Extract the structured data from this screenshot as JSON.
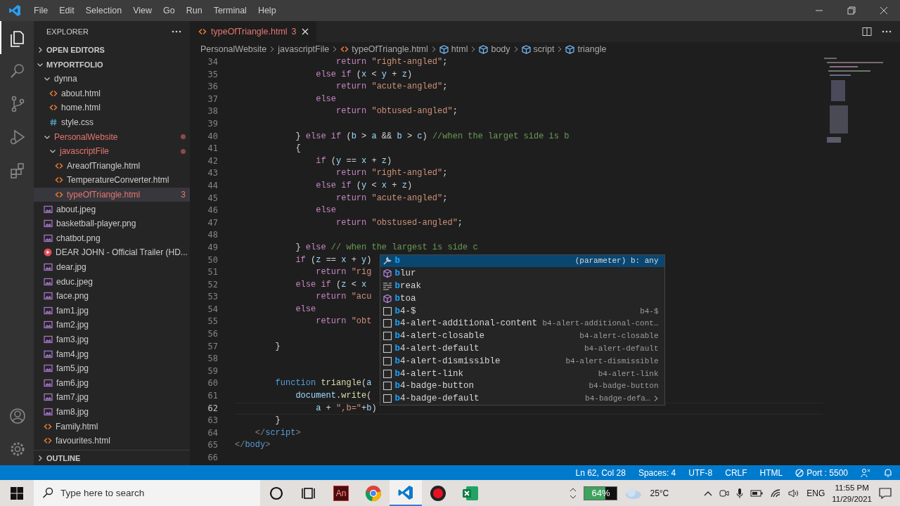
{
  "menu": [
    "File",
    "Edit",
    "Selection",
    "View",
    "Go",
    "Run",
    "Terminal",
    "Help"
  ],
  "activity_bar": [
    {
      "kind": "files",
      "selected": true
    },
    {
      "kind": "search",
      "selected": false
    },
    {
      "kind": "source-control",
      "selected": false
    },
    {
      "kind": "run",
      "selected": false
    },
    {
      "kind": "extensions",
      "selected": false
    },
    {
      "kind": "account",
      "selected": false
    },
    {
      "kind": "settings",
      "selected": false
    }
  ],
  "sidebar": {
    "title": "EXPLORER",
    "sections": [
      {
        "label": "OPEN EDITORS",
        "expanded": false
      },
      {
        "label": "MYPORTFOLIO",
        "expanded": true,
        "children": [
          {
            "kind": "folder",
            "name": "dynna",
            "expanded": true,
            "selected": false,
            "error": false,
            "children": [
              {
                "kind": "html",
                "name": "about.html",
                "selected": false,
                "error": false
              },
              {
                "kind": "html",
                "name": "home.html",
                "selected": false,
                "error": false
              },
              {
                "kind": "css",
                "name": "style.css",
                "selected": false,
                "error": false
              }
            ]
          },
          {
            "kind": "folder",
            "name": "PersonalWebsite",
            "expanded": true,
            "selected": false,
            "error": true,
            "children": [
              {
                "kind": "folder",
                "name": "javascriptFile",
                "expanded": true,
                "selected": false,
                "error": true,
                "children": [
                  {
                    "kind": "html",
                    "name": "AreaofTriangle.html",
                    "selected": false,
                    "error": false
                  },
                  {
                    "kind": "html",
                    "name": "TemperatureConverter.html",
                    "selected": false,
                    "error": false
                  },
                  {
                    "kind": "html",
                    "name": "typeOfTriangle.html",
                    "selected": true,
                    "error": true,
                    "badge": "3"
                  }
                ]
              }
            ]
          },
          {
            "kind": "image",
            "name": "about.jpeg",
            "selected": false,
            "error": false
          },
          {
            "kind": "image",
            "name": "basketball-player.png",
            "selected": false,
            "error": false
          },
          {
            "kind": "image",
            "name": "chatbot.png",
            "selected": false,
            "error": false
          },
          {
            "kind": "video",
            "name": "DEAR JOHN - Official Trailer (HD...",
            "selected": false,
            "error": false
          },
          {
            "kind": "image",
            "name": "dear.jpg",
            "selected": false,
            "error": false
          },
          {
            "kind": "image",
            "name": "educ.jpeg",
            "selected": false,
            "error": false
          },
          {
            "kind": "image",
            "name": "face.png",
            "selected": false,
            "error": false
          },
          {
            "kind": "image",
            "name": "fam1.jpg",
            "selected": false,
            "error": false
          },
          {
            "kind": "image",
            "name": "fam2.jpg",
            "selected": false,
            "error": false
          },
          {
            "kind": "image",
            "name": "fam3.jpg",
            "selected": false,
            "error": false
          },
          {
            "kind": "image",
            "name": "fam4.jpg",
            "selected": false,
            "error": false
          },
          {
            "kind": "image",
            "name": "fam5.jpg",
            "selected": false,
            "error": false
          },
          {
            "kind": "image",
            "name": "fam6.jpg",
            "selected": false,
            "error": false
          },
          {
            "kind": "image",
            "name": "fam7.jpg",
            "selected": false,
            "error": false
          },
          {
            "kind": "image",
            "name": "fam8.jpg",
            "selected": false,
            "error": false
          },
          {
            "kind": "html",
            "name": "Family.html",
            "selected": false,
            "error": false
          },
          {
            "kind": "html",
            "name": "favourites.html",
            "selected": false,
            "error": false
          }
        ]
      }
    ],
    "outline": {
      "label": "OUTLINE",
      "expanded": false
    }
  },
  "tabs": [
    {
      "label": "typeOfTriangle.html",
      "badge": "3",
      "error": true,
      "selected": true
    }
  ],
  "breadcrumbs": [
    {
      "kind": "folder",
      "label": "PersonalWebsite"
    },
    {
      "kind": "folder",
      "label": "javascriptFile"
    },
    {
      "kind": "html",
      "label": "typeOfTriangle.html"
    },
    {
      "kind": "element",
      "label": "html"
    },
    {
      "kind": "element",
      "label": "body"
    },
    {
      "kind": "element",
      "label": "script"
    },
    {
      "kind": "element",
      "label": "triangle"
    }
  ],
  "code": {
    "lines": [
      {
        "number": "34",
        "current": false,
        "tokens": [
          {
            "kind": "keyword",
            "text": "                    return"
          },
          {
            "kind": "string",
            "text": " \"right-angled\""
          },
          {
            "kind": "plain",
            "text": ";"
          }
        ]
      },
      {
        "number": "35",
        "current": false,
        "tokens": [
          {
            "kind": "keyword",
            "text": "                else if"
          },
          {
            "kind": "plain",
            "text": " ("
          },
          {
            "kind": "variable",
            "text": "x"
          },
          {
            "kind": "plain",
            "text": " < "
          },
          {
            "kind": "variable",
            "text": "y"
          },
          {
            "kind": "plain",
            "text": " + "
          },
          {
            "kind": "variable",
            "text": "z"
          },
          {
            "kind": "plain",
            "text": ")"
          }
        ]
      },
      {
        "number": "36",
        "current": false,
        "tokens": [
          {
            "kind": "keyword",
            "text": "                    return"
          },
          {
            "kind": "string",
            "text": " \"acute-angled\""
          },
          {
            "kind": "plain",
            "text": ";"
          }
        ]
      },
      {
        "number": "37",
        "current": false,
        "tokens": [
          {
            "kind": "keyword",
            "text": "                else"
          }
        ]
      },
      {
        "number": "38",
        "current": false,
        "tokens": [
          {
            "kind": "keyword",
            "text": "                    return"
          },
          {
            "kind": "string",
            "text": " \"obtused-angled\""
          },
          {
            "kind": "plain",
            "text": ";"
          }
        ]
      },
      {
        "number": "39",
        "current": false
      },
      {
        "number": "40",
        "current": false,
        "tokens": [
          {
            "kind": "plain",
            "text": "            } "
          },
          {
            "kind": "keyword",
            "text": "else if"
          },
          {
            "kind": "plain",
            "text": " ("
          },
          {
            "kind": "variable",
            "text": "b"
          },
          {
            "kind": "plain",
            "text": " > "
          },
          {
            "kind": "variable",
            "text": "a"
          },
          {
            "kind": "plain",
            "text": " && "
          },
          {
            "kind": "variable",
            "text": "b"
          },
          {
            "kind": "plain",
            "text": " > "
          },
          {
            "kind": "variable",
            "text": "c"
          },
          {
            "kind": "plain",
            "text": ") "
          },
          {
            "kind": "comment",
            "text": "//when the larget side is b"
          }
        ]
      },
      {
        "number": "41",
        "current": false,
        "tokens": [
          {
            "kind": "plain",
            "text": "            {"
          }
        ]
      },
      {
        "number": "42",
        "current": false,
        "tokens": [
          {
            "kind": "keyword",
            "text": "                if"
          },
          {
            "kind": "plain",
            "text": " ("
          },
          {
            "kind": "variable",
            "text": "y"
          },
          {
            "kind": "plain",
            "text": " == "
          },
          {
            "kind": "variable",
            "text": "x"
          },
          {
            "kind": "plain",
            "text": " + "
          },
          {
            "kind": "variable",
            "text": "z"
          },
          {
            "kind": "plain",
            "text": ")"
          }
        ]
      },
      {
        "number": "43",
        "current": false,
        "tokens": [
          {
            "kind": "keyword",
            "text": "                    return"
          },
          {
            "kind": "string",
            "text": " \"right-angled\""
          },
          {
            "kind": "plain",
            "text": ";"
          }
        ]
      },
      {
        "number": "44",
        "current": false,
        "tokens": [
          {
            "kind": "keyword",
            "text": "                else if"
          },
          {
            "kind": "plain",
            "text": " ("
          },
          {
            "kind": "variable",
            "text": "y"
          },
          {
            "kind": "plain",
            "text": " < "
          },
          {
            "kind": "variable",
            "text": "x"
          },
          {
            "kind": "plain",
            "text": " + "
          },
          {
            "kind": "variable",
            "text": "z"
          },
          {
            "kind": "plain",
            "text": ")"
          }
        ]
      },
      {
        "number": "45",
        "current": false,
        "tokens": [
          {
            "kind": "keyword",
            "text": "                    return"
          },
          {
            "kind": "string",
            "text": " \"acute-angled\""
          },
          {
            "kind": "plain",
            "text": ";"
          }
        ]
      },
      {
        "number": "46",
        "current": false,
        "tokens": [
          {
            "kind": "keyword",
            "text": "                else"
          }
        ]
      },
      {
        "number": "47",
        "current": false,
        "tokens": [
          {
            "kind": "keyword",
            "text": "                    return"
          },
          {
            "kind": "string",
            "text": " \"obstused-angled\""
          },
          {
            "kind": "plain",
            "text": ";"
          }
        ]
      },
      {
        "number": "48",
        "current": false
      },
      {
        "number": "49",
        "current": false,
        "tokens": [
          {
            "kind": "plain",
            "text": "            } "
          },
          {
            "kind": "keyword",
            "text": "else"
          },
          {
            "kind": "comment",
            "text": " // when the largest is side c"
          }
        ]
      },
      {
        "number": "50",
        "current": false,
        "tokens": [
          {
            "kind": "keyword",
            "text": "            if"
          },
          {
            "kind": "plain",
            "text": " ("
          },
          {
            "kind": "variable",
            "text": "z"
          },
          {
            "kind": "plain",
            "text": " == "
          },
          {
            "kind": "variable",
            "text": "x"
          },
          {
            "kind": "plain",
            "text": " + "
          },
          {
            "kind": "variable",
            "text": "y"
          },
          {
            "kind": "plain",
            "text": ")"
          }
        ]
      },
      {
        "number": "51",
        "current": false,
        "tokens": [
          {
            "kind": "keyword",
            "text": "                return"
          },
          {
            "kind": "string",
            "text": " \"rig"
          }
        ]
      },
      {
        "number": "52",
        "current": false,
        "tokens": [
          {
            "kind": "keyword",
            "text": "            else if"
          },
          {
            "kind": "plain",
            "text": " ("
          },
          {
            "kind": "variable",
            "text": "z"
          },
          {
            "kind": "plain",
            "text": " < "
          },
          {
            "kind": "variable",
            "text": "x"
          }
        ]
      },
      {
        "number": "53",
        "current": false,
        "tokens": [
          {
            "kind": "keyword",
            "text": "                return"
          },
          {
            "kind": "string",
            "text": " \"acu"
          }
        ]
      },
      {
        "number": "54",
        "current": false,
        "tokens": [
          {
            "kind": "keyword",
            "text": "            else"
          }
        ]
      },
      {
        "number": "55",
        "current": false,
        "tokens": [
          {
            "kind": "keyword",
            "text": "                return"
          },
          {
            "kind": "string",
            "text": " \"obt"
          }
        ]
      },
      {
        "number": "56",
        "current": false
      },
      {
        "number": "57",
        "current": false,
        "tokens": [
          {
            "kind": "plain",
            "text": "        }"
          }
        ]
      },
      {
        "number": "58",
        "current": false
      },
      {
        "number": "59",
        "current": false
      },
      {
        "number": "60",
        "current": false,
        "tokens": [
          {
            "kind": "storage",
            "text": "        function"
          },
          {
            "kind": "function",
            "text": " triangle"
          },
          {
            "kind": "plain",
            "text": "("
          },
          {
            "kind": "variable",
            "text": "a"
          }
        ]
      },
      {
        "number": "61",
        "current": false,
        "tokens": [
          {
            "kind": "variable",
            "text": "            document"
          },
          {
            "kind": "plain",
            "text": "."
          },
          {
            "kind": "function",
            "text": "write"
          },
          {
            "kind": "plain",
            "text": "("
          }
        ]
      },
      {
        "number": "62",
        "current": true,
        "tokens": [
          {
            "kind": "variable",
            "text": "                a"
          },
          {
            "kind": "plain",
            "text": " + "
          },
          {
            "kind": "string",
            "text": "\",b=\""
          },
          {
            "kind": "plain",
            "text": "+"
          },
          {
            "kind": "variable",
            "text": "b"
          },
          {
            "kind": "plain",
            "text": ")"
          }
        ]
      },
      {
        "number": "63",
        "current": false,
        "tokens": [
          {
            "kind": "plain",
            "text": "        }"
          }
        ]
      },
      {
        "number": "64",
        "current": false,
        "tokens": [
          {
            "kind": "bracket",
            "text": "    </"
          },
          {
            "kind": "tag",
            "text": "script"
          },
          {
            "kind": "bracket",
            "text": ">"
          }
        ]
      },
      {
        "number": "65",
        "current": false,
        "tokens": [
          {
            "kind": "bracket",
            "text": "</"
          },
          {
            "kind": "tag",
            "text": "body"
          },
          {
            "kind": "bracket",
            "text": ">"
          }
        ]
      },
      {
        "number": "66",
        "current": false
      }
    ]
  },
  "suggest": {
    "items": [
      {
        "kind": "parameter",
        "label": "b",
        "detail": "(parameter) b: any",
        "selected": true
      },
      {
        "kind": "method",
        "label": "blur",
        "selected": false
      },
      {
        "kind": "keyword",
        "label": "break",
        "selected": false
      },
      {
        "kind": "method",
        "label": "btoa",
        "selected": false
      },
      {
        "kind": "snippet",
        "label": "b4-$",
        "detail": "b4-$",
        "selected": false
      },
      {
        "kind": "snippet",
        "label": "b4-alert-additional-content",
        "detail": "b4-alert-additional-cont…",
        "selected": false
      },
      {
        "kind": "snippet",
        "label": "b4-alert-closable",
        "detail": "b4-alert-closable",
        "selected": false
      },
      {
        "kind": "snippet",
        "label": "b4-alert-default",
        "detail": "b4-alert-default",
        "selected": false
      },
      {
        "kind": "snippet",
        "label": "b4-alert-dismissible",
        "detail": "b4-alert-dismissible",
        "selected": false
      },
      {
        "kind": "snippet",
        "label": "b4-alert-link",
        "detail": "b4-alert-link",
        "selected": false
      },
      {
        "kind": "snippet",
        "label": "b4-badge-button",
        "detail": "b4-badge-button",
        "selected": false
      },
      {
        "kind": "snippet",
        "label": "b4-badge-default",
        "detail": "b4-badge-defa…",
        "selected": false,
        "expandable": true
      }
    ]
  },
  "status_bar": {
    "items": [
      {
        "kind": "text",
        "label": "Ln 62, Col 28"
      },
      {
        "kind": "text",
        "label": "Spaces: 4"
      },
      {
        "kind": "text",
        "label": "UTF-8"
      },
      {
        "kind": "text",
        "label": "CRLF"
      },
      {
        "kind": "text",
        "label": "HTML"
      },
      {
        "kind": "port",
        "label": "Port : 5500"
      }
    ]
  },
  "taskbar": {
    "search": {
      "placeholder": "Type here to search"
    },
    "apps": [
      {
        "kind": "cortana",
        "selected": false
      },
      {
        "kind": "task-view",
        "selected": false
      },
      {
        "kind": "animate",
        "label": "An",
        "selected": false
      },
      {
        "kind": "chrome",
        "selected": false
      },
      {
        "kind": "vscode",
        "selected": true
      },
      {
        "kind": "recorder",
        "selected": false
      },
      {
        "kind": "excel",
        "selected": false
      }
    ],
    "meter": {
      "reading": "64%",
      "level": 0.64
    },
    "temperature": "25°C",
    "language": "ENG",
    "time": "11:55 PM",
    "date": "11/29/2021"
  }
}
